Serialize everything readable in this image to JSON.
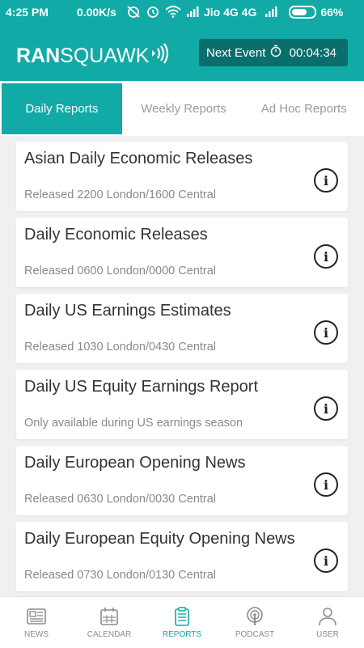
{
  "status_bar": {
    "time": "4:25 PM",
    "speed": "0.00K/s",
    "carrier": "Jio 4G 4G",
    "battery": "66%"
  },
  "header": {
    "logo_bold": "RAN",
    "logo_thin": "SQUAWK",
    "next_event_label": "Next Event",
    "countdown": "00:04:34"
  },
  "tabs": [
    {
      "label": "Daily Reports",
      "active": true
    },
    {
      "label": "Weekly Reports",
      "active": false
    },
    {
      "label": "Ad Hoc Reports",
      "active": false
    }
  ],
  "reports": [
    {
      "title": "Asian Daily Economic Releases",
      "subtitle": "Released 2200 London/1600 Central"
    },
    {
      "title": "Daily Economic Releases",
      "subtitle": "Released 0600 London/0000 Central"
    },
    {
      "title": "Daily US Earnings Estimates",
      "subtitle": "Released 1030 London/0430 Central"
    },
    {
      "title": "Daily US Equity Earnings Report",
      "subtitle": "Only available during US earnings season"
    },
    {
      "title": "Daily European Opening News",
      "subtitle": "Released 0630 London/0030 Central"
    },
    {
      "title": "Daily European Equity Opening News",
      "subtitle": "Released 0730 London/0130 Central"
    }
  ],
  "bottom_nav": [
    {
      "label": "NEWS",
      "icon": "newspaper-icon",
      "active": false
    },
    {
      "label": "CALENDAR",
      "icon": "calendar-icon",
      "active": false
    },
    {
      "label": "REPORTS",
      "icon": "clipboard-icon",
      "active": true
    },
    {
      "label": "PODCAST",
      "icon": "podcast-icon",
      "active": false
    },
    {
      "label": "USER",
      "icon": "user-icon",
      "active": false
    }
  ],
  "colors": {
    "accent": "#12aaa6",
    "dark_accent": "#0a6f6c"
  }
}
